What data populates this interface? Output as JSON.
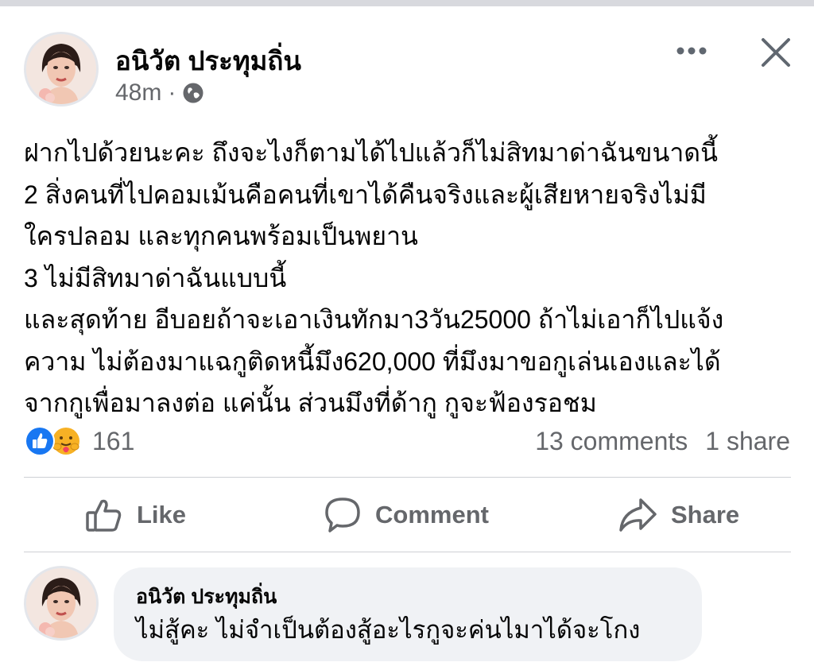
{
  "post": {
    "author": "อนิวัต ประทุมถิ่น",
    "time": "48m",
    "separator": "·",
    "privacy_icon": "globe-icon",
    "body_lines": [
      "ฝากไปด้วยนะคะ ถึงจะไงก็ตามได้ไปแล้วก็ไม่สิทมาด่าฉันขนาดนี้",
      "2 สิ่งคนที่ไปคอมเม้นคือคนที่เขาได้คืนจริงและผู้เสียหายจริงไม่มี",
      "ใครปลอม และทุกคนพร้อมเป็นพยาน",
      "3 ไม่มีสิทมาด่าฉันแบบนี้",
      "และสุดท้าย อีบอยถ้าจะเอาเงินทักมา3วัน25000 ถ้าไม่เอาก็ไปแจ้ง",
      "ความ ไม่ต้องมาแฉกูติดหนี้มึง620,000 ที่มึงมาขอกูเล่นเองและได้",
      "จากกูเพื่อมาลงต่อ แค่นั้น ส่วนมึงที่ด้ากู กูจะฟ้องรอชม"
    ]
  },
  "reactions": {
    "icons": [
      "like-icon",
      "care-icon"
    ],
    "count": "161",
    "comments": "13 comments",
    "shares": "1 share"
  },
  "actions": {
    "like": "Like",
    "comment": "Comment",
    "share": "Share"
  },
  "comment": {
    "author": "อนิวัต ประทุมถิ่น",
    "text": "ไม่สู้คะ ไม่จำเป็นต้องสู้อะไรกูจะค่นไมาได้จะโกง"
  },
  "colors": {
    "text": "#050505",
    "secondary": "#65676b",
    "like_blue": "#1877f2",
    "bubble_bg": "#f0f2f5",
    "divider": "#ced0d4"
  }
}
